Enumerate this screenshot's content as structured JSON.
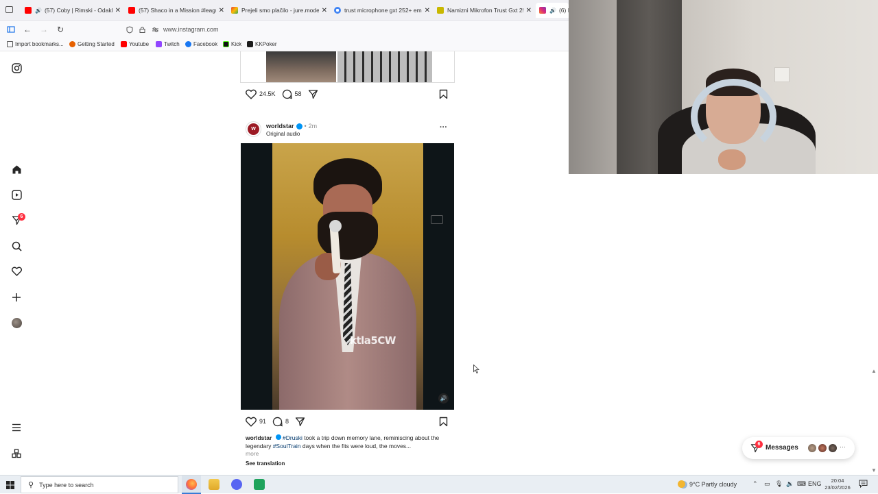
{
  "browser": {
    "tabs": [
      {
        "label": "(57) Coby | Rimski - Odakle",
        "icon": "youtube-icon",
        "audio": true
      },
      {
        "label": "(57) Shaco in a Mission #league",
        "icon": "youtube-icon",
        "audio": false
      },
      {
        "label": "Prejeli smo plačilo - jure.modec",
        "icon": "gmail-icon",
        "audio": false
      },
      {
        "label": "trust microphone gxt 252+ emit",
        "icon": "google-icon",
        "audio": false
      },
      {
        "label": "Namizni Mikrofon Trust Gxt 252",
        "icon": "mimovrste-icon",
        "audio": false
      },
      {
        "label": "(6) I",
        "icon": "instagram-icon",
        "audio": true
      }
    ],
    "url": "www.instagram.com",
    "bookmarks": [
      {
        "label": "Import bookmarks...",
        "icon": "import-icon"
      },
      {
        "label": "Getting Started",
        "icon": "firefox-icon"
      },
      {
        "label": "Youtube",
        "icon": "youtube-icon"
      },
      {
        "label": "Twitch",
        "icon": "twitch-icon"
      },
      {
        "label": "Facebook",
        "icon": "facebook-icon"
      },
      {
        "label": "Kick",
        "icon": "kick-icon"
      },
      {
        "label": "KKPoker",
        "icon": "kkpoker-icon"
      }
    ]
  },
  "sidebar": {
    "notifications_badge": "6",
    "icons": [
      "instagram-logo-icon",
      "home-icon",
      "reels-icon",
      "direct-icon",
      "search-icon",
      "heart-icon",
      "create-icon",
      "profile-avatar",
      "menu-icon",
      "more-apps-icon"
    ]
  },
  "prev_post": {
    "likes": "24.5K",
    "comments": "58"
  },
  "post": {
    "username": "worldstar",
    "time": "2m",
    "separator": "•",
    "audio": "Original audio",
    "video_logo": "ktla5CW",
    "likes": "91",
    "comments": "8",
    "caption_user": "worldstar",
    "caption_tag1": "#Druski",
    "caption_text1": " took a trip down memory lane, reminiscing about the legendary ",
    "caption_tag2": "#SoulTrain",
    "caption_text2": " days when the fits were loud, the moves...",
    "more": "more",
    "see_translation": "See translation"
  },
  "messages": {
    "label": "Messages",
    "badge": "6"
  },
  "taskbar": {
    "search_placeholder": "Type here to search",
    "weather": "9°C  Partly cloudy",
    "language": "ENG",
    "time": "20:04",
    "date": "23/02/2026"
  },
  "colors": {
    "badge": "#ff3040",
    "link_blue": "#00376b",
    "verified": "#0095f6"
  }
}
